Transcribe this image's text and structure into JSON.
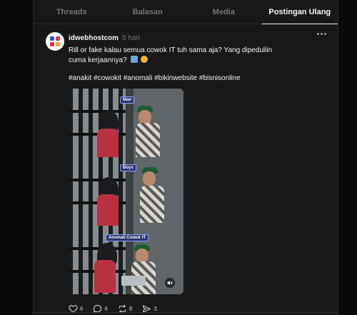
{
  "tabs": [
    {
      "label": "Threads",
      "active": false
    },
    {
      "label": "Balasan",
      "active": false
    },
    {
      "label": "Media",
      "active": false
    },
    {
      "label": "Postingan Ulang",
      "active": true
    }
  ],
  "post": {
    "username": "idwebhostcom",
    "time": "5 hari",
    "caption": "Rill or fake kalau semua cowok IT tuh sama aja? Yang dipeduliin cuma kerjaannya?",
    "emojis": [
      "laptop-technologist-emoji",
      "tongue-wink-emoji"
    ],
    "hashtags": "#anakit #cowokit #anomali #bikinwebsite #bisnisonline",
    "media": {
      "panels": [
        {
          "label": "Man"
        },
        {
          "label": "Boys"
        },
        {
          "label": "Anomali Cowok IT"
        }
      ],
      "muted": true
    },
    "stats": {
      "likes": "6",
      "replies": "6",
      "reposts": "8",
      "shares": "3"
    }
  },
  "colors": {
    "background": "#0a0a0a",
    "panel": "#181818",
    "text_primary": "#f3f5f7",
    "text_muted": "#777777",
    "avatar_logo": "#e0314a"
  }
}
